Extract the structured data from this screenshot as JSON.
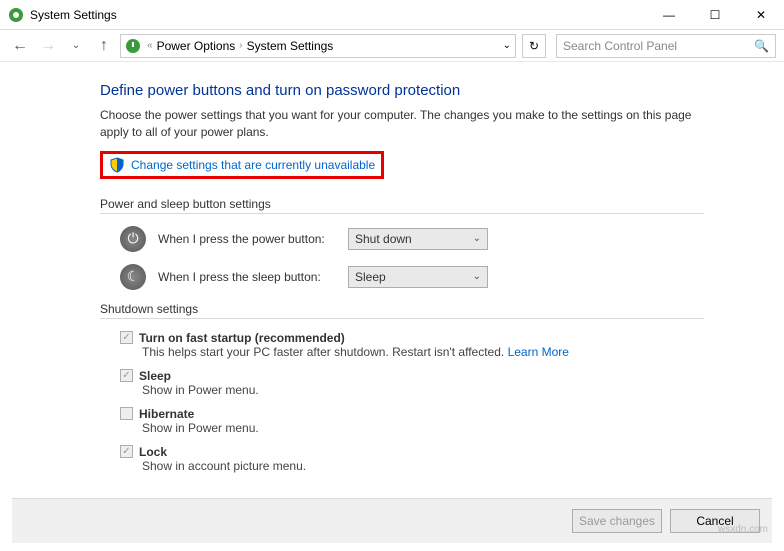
{
  "window": {
    "title": "System Settings"
  },
  "breadcrumbs": {
    "item1": "Power Options",
    "item2": "System Settings"
  },
  "search": {
    "placeholder": "Search Control Panel"
  },
  "heading": "Define power buttons and turn on password protection",
  "description": "Choose the power settings that you want for your computer. The changes you make to the settings on this page apply to all of your power plans.",
  "change_link": "Change settings that are currently unavailable",
  "section_power": "Power and sleep button settings",
  "power_row": {
    "label": "When I press the power button:",
    "value": "Shut down"
  },
  "sleep_row": {
    "label": "When I press the sleep button:",
    "value": "Sleep"
  },
  "section_shutdown": "Shutdown settings",
  "fast": {
    "label": "Turn on fast startup (recommended)",
    "help": "This helps start your PC faster after shutdown. Restart isn't affected. ",
    "learn": "Learn More"
  },
  "sleep_chk": {
    "label": "Sleep",
    "help": "Show in Power menu."
  },
  "hibernate": {
    "label": "Hibernate",
    "help": "Show in Power menu."
  },
  "lock": {
    "label": "Lock",
    "help": "Show in account picture menu."
  },
  "buttons": {
    "save": "Save changes",
    "cancel": "Cancel"
  },
  "watermark": "wsxdn.com"
}
